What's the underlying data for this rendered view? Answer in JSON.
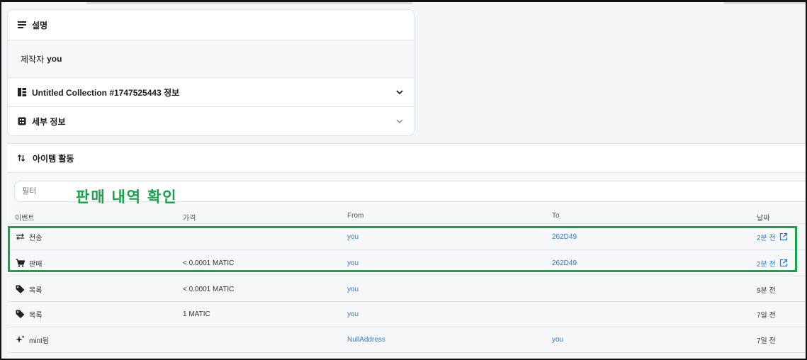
{
  "description": {
    "title": "설명",
    "creator_label": "제작자",
    "creator_name": "you"
  },
  "collection": {
    "title": "Untitled Collection #1747525443 정보"
  },
  "details": {
    "title": "세부 정보"
  },
  "activity": {
    "title": "아이템 활동",
    "filter_placeholder": "필터",
    "annotation": "판매 내역 확인",
    "columns": [
      "이벤트",
      "가격",
      "From",
      "To",
      "날짜"
    ],
    "rows": [
      {
        "event": "전송",
        "icon": "transfer-icon",
        "price": "",
        "from": "you",
        "to": "262D49",
        "date": "2분 전",
        "date_link": true
      },
      {
        "event": "판매",
        "icon": "cart-icon",
        "price": "< 0.0001 MATIC",
        "from": "you",
        "to": "262D49",
        "date": "2분 전",
        "date_link": true
      },
      {
        "event": "목록",
        "icon": "tag-icon",
        "price": "< 0.0001 MATIC",
        "from": "you",
        "to": "",
        "date": "9분 전",
        "date_link": false
      },
      {
        "event": "목록",
        "icon": "tag-icon",
        "price": "1 MATIC",
        "from": "you",
        "to": "",
        "date": "7일 전",
        "date_link": false
      },
      {
        "event": "mint됨",
        "icon": "sparkle-icon",
        "price": "",
        "from": "NullAddress",
        "to": "you",
        "date": "7일 전",
        "date_link": false
      }
    ]
  },
  "colors": {
    "link": "#2d7ad6",
    "highlight": "#16a34a"
  }
}
